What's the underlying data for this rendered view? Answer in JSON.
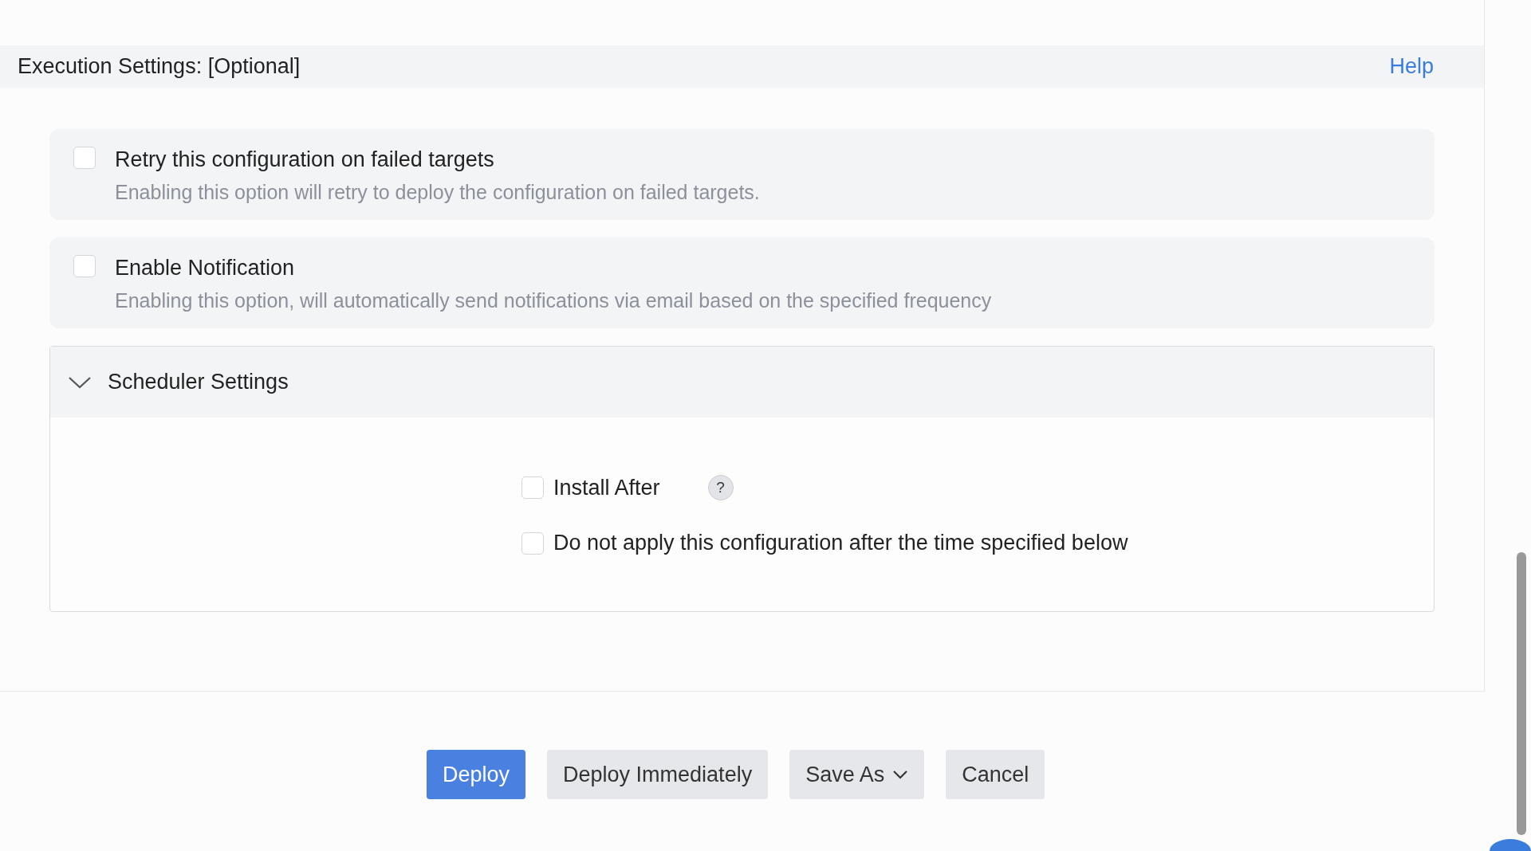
{
  "section": {
    "title": "Execution Settings: [Optional]",
    "help_link": "Help"
  },
  "options": [
    {
      "label": "Retry this configuration on failed targets",
      "description": "Enabling this option will retry to deploy the configuration on failed targets.",
      "checked": false
    },
    {
      "label": "Enable Notification",
      "description": "Enabling this option, will automatically send notifications via email based on the specified frequency",
      "checked": false
    }
  ],
  "scheduler": {
    "title": "Scheduler Settings",
    "expanded": true,
    "items": [
      {
        "label": "Install After",
        "checked": false,
        "help": "?"
      },
      {
        "label": "Do not apply this configuration after the time specified below",
        "checked": false
      }
    ]
  },
  "buttons": [
    {
      "label": "Deploy",
      "kind": "primary"
    },
    {
      "label": "Deploy Immediately",
      "kind": "secondary"
    },
    {
      "label": "Save As",
      "kind": "dropdown"
    },
    {
      "label": "Cancel",
      "kind": "secondary"
    }
  ]
}
